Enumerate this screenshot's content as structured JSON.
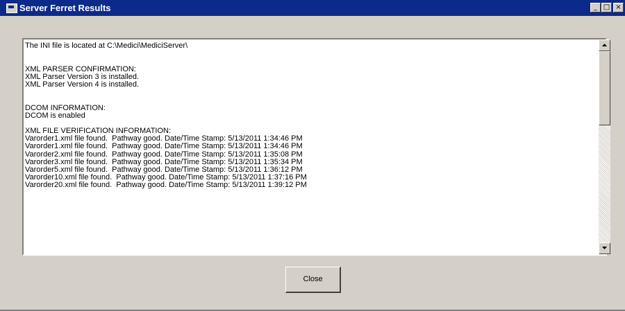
{
  "window": {
    "title": "Server Ferret Results",
    "controls": {
      "minimize": "_",
      "maximize": "□",
      "close": "×"
    }
  },
  "results": {
    "lines": [
      "The INI file is located at C:\\Medici\\MediciServer\\",
      "",
      "",
      "XML PARSER CONFIRMATION:",
      "XML Parser Version 3 is installed.",
      "XML Parser Version 4 is installed.",
      "",
      "",
      "DCOM INFORMATION:",
      "DCOM is enabled",
      "",
      "XML FILE VERIFICATION INFORMATION:",
      "Varorder1.xml file found.  Pathway good. Date/Time Stamp: 5/13/2011 1:34:46 PM",
      "Varorder1.xml file found.  Pathway good. Date/Time Stamp: 5/13/2011 1:34:46 PM",
      "Varorder2.xml file found.  Pathway good. Date/Time Stamp: 5/13/2011 1:35:08 PM",
      "Varorder3.xml file found.  Pathway good. Date/Time Stamp: 5/13/2011 1:35:34 PM",
      "Varorder5.xml file found.  Pathway good. Date/Time Stamp: 5/13/2011 1:36:12 PM",
      "Varorder10.xml file found.  Pathway good. Date/Time Stamp: 5/13/2011 1:37:16 PM",
      "Varorder20.xml file found.  Pathway good. Date/Time Stamp: 5/13/2011 1:39:12 PM"
    ]
  },
  "buttons": {
    "close_label": "Close"
  },
  "colors": {
    "titlebar": "#0b2a8c",
    "face": "#d4d0c8"
  }
}
